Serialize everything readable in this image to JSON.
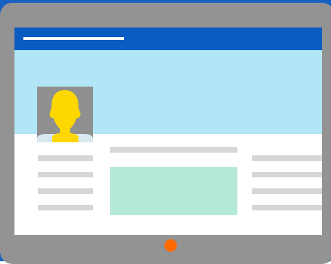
{
  "colors": {
    "background": "#1760c1",
    "device_frame": "#939393",
    "screen": "#ffffff",
    "header": "#0a5cc2",
    "header_line": "#ffffff",
    "cover": "#b2e5f5",
    "avatar_bg": "#8f8f8f",
    "avatar_figure": "#ffd700",
    "avatar_shirt": "#d8e8f0",
    "placeholder_line": "#d6d6d6",
    "content_block": "#b5ead6",
    "home_button": "#ff6a00"
  },
  "icons": {
    "avatar": "person-silhouette-icon",
    "home": "home-button-icon"
  }
}
